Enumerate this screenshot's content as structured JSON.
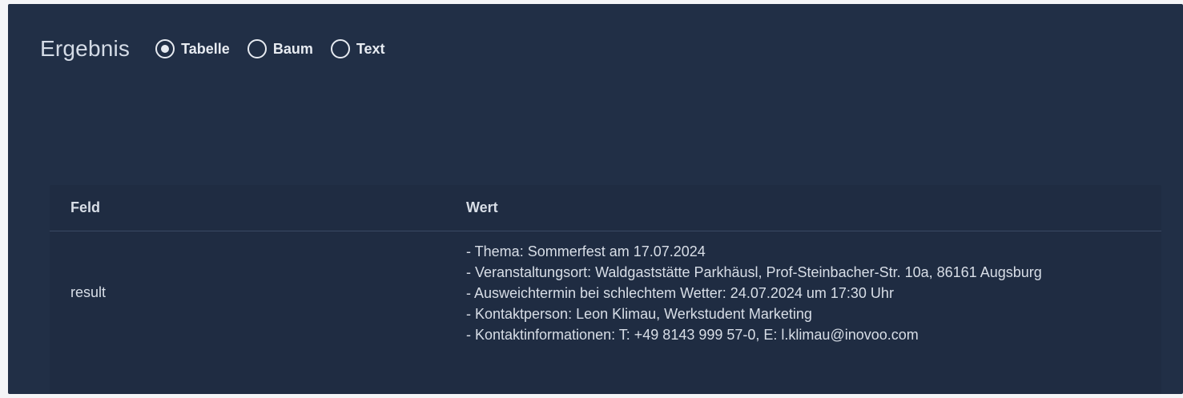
{
  "header": {
    "title": "Ergebnis",
    "view_options": [
      {
        "label": "Tabelle",
        "selected": true
      },
      {
        "label": "Baum",
        "selected": false
      },
      {
        "label": "Text",
        "selected": false
      }
    ]
  },
  "table": {
    "columns": [
      "Feld",
      "Wert"
    ],
    "rows": [
      {
        "field": "result",
        "value_lines": [
          "- Thema: Sommerfest am 17.07.2024",
          "- Veranstaltungsort: Waldgaststätte Parkhäusl, Prof-Steinbacher-Str. 10a, 86161 Augsburg",
          "- Ausweichtermin bei schlechtem Wetter: 24.07.2024 um 17:30 Uhr",
          "- Kontaktperson: Leon Klimau, Werkstudent Marketing",
          "- Kontaktinformationen: T: +49 8143 999 57-0, E: l.klimau@inovoo.com"
        ]
      }
    ]
  },
  "colors": {
    "panel_background": "#212f46",
    "text": "#d8dee7",
    "radio": "#e7ebf1"
  }
}
